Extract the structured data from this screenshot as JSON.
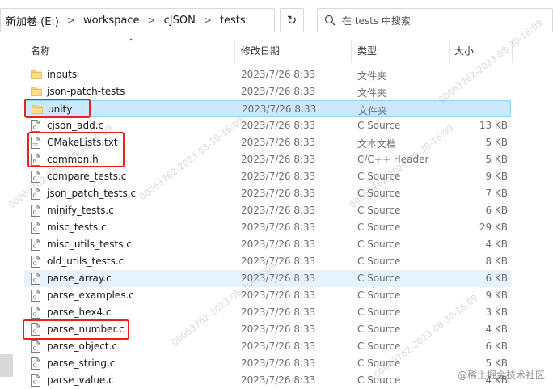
{
  "address_bar": {
    "segments": [
      "新加卷 (E:)",
      "workspace",
      "cJSON",
      "tests"
    ],
    "separator": ">"
  },
  "search": {
    "placeholder": "在 tests 中搜索"
  },
  "columns": {
    "name": "名称",
    "date": "修改日期",
    "type": "类型",
    "size": "大小"
  },
  "rows": [
    {
      "name": "inputs",
      "date": "2023/7/26 8:33",
      "type": "文件夹",
      "size": "",
      "icon": "folder-icon"
    },
    {
      "name": "json-patch-tests",
      "date": "2023/7/26 8:33",
      "type": "文件夹",
      "size": "",
      "icon": "folder-icon"
    },
    {
      "name": "unity",
      "date": "2023/7/26 8:33",
      "type": "文件夹",
      "size": "",
      "icon": "folder-icon"
    },
    {
      "name": "cjson_add.c",
      "date": "2023/7/26 8:33",
      "type": "C Source",
      "size": "13 KB",
      "icon": "c-file-icon"
    },
    {
      "name": "CMakeLists.txt",
      "date": "2023/7/26 8:33",
      "type": "文本文档",
      "size": "5 KB",
      "icon": "text-file-icon"
    },
    {
      "name": "common.h",
      "date": "2023/7/26 8:33",
      "type": "C/C++ Header",
      "size": "5 KB",
      "icon": "h-file-icon"
    },
    {
      "name": "compare_tests.c",
      "date": "2023/7/26 8:33",
      "type": "C Source",
      "size": "9 KB",
      "icon": "c-file-icon"
    },
    {
      "name": "json_patch_tests.c",
      "date": "2023/7/26 8:33",
      "type": "C Source",
      "size": "7 KB",
      "icon": "c-file-icon"
    },
    {
      "name": "minify_tests.c",
      "date": "2023/7/26 8:33",
      "type": "C Source",
      "size": "6 KB",
      "icon": "c-file-icon"
    },
    {
      "name": "misc_tests.c",
      "date": "2023/7/26 8:33",
      "type": "C Source",
      "size": "29 KB",
      "icon": "c-file-icon"
    },
    {
      "name": "misc_utils_tests.c",
      "date": "2023/7/26 8:33",
      "type": "C Source",
      "size": "4 KB",
      "icon": "c-file-icon"
    },
    {
      "name": "old_utils_tests.c",
      "date": "2023/7/26 8:33",
      "type": "C Source",
      "size": "8 KB",
      "icon": "c-file-icon"
    },
    {
      "name": "parse_array.c",
      "date": "2023/7/26 8:33",
      "type": "C Source",
      "size": "6 KB",
      "icon": "c-file-icon"
    },
    {
      "name": "parse_examples.c",
      "date": "2023/7/26 8:33",
      "type": "C Source",
      "size": "9 KB",
      "icon": "c-file-icon"
    },
    {
      "name": "parse_hex4.c",
      "date": "2023/7/26 8:33",
      "type": "C Source",
      "size": "3 KB",
      "icon": "c-file-icon"
    },
    {
      "name": "parse_number.c",
      "date": "2023/7/26 8:33",
      "type": "C Source",
      "size": "4 KB",
      "icon": "c-file-icon"
    },
    {
      "name": "parse_object.c",
      "date": "2023/7/26 8:33",
      "type": "C Source",
      "size": "6 KB",
      "icon": "c-file-icon"
    },
    {
      "name": "parse_string.c",
      "date": "2023/7/26 8:33",
      "type": "C Source",
      "size": "5 KB",
      "icon": "c-file-icon"
    },
    {
      "name": "parse_value.c",
      "date": "2023/7/26 8:33",
      "type": "C Source",
      "size": "4 KB",
      "icon": "c-file-icon"
    }
  ],
  "selected_row": "unity",
  "hover_row": "parse_array.c",
  "highlighted_items": [
    "unity",
    "CMakeLists.txt",
    "common.h",
    "parse_number.c"
  ],
  "watermark_text": "00063762-2023-08-30-16:09",
  "brand": "@稀土掘金技术社区",
  "colors": {
    "selection": "#cce8ff",
    "selection_border": "#99d1ff",
    "hover": "#e5f3ff",
    "highlight_box": "#e8231c",
    "folder": "#f8d775",
    "secondary_text": "#6d6d6d"
  }
}
